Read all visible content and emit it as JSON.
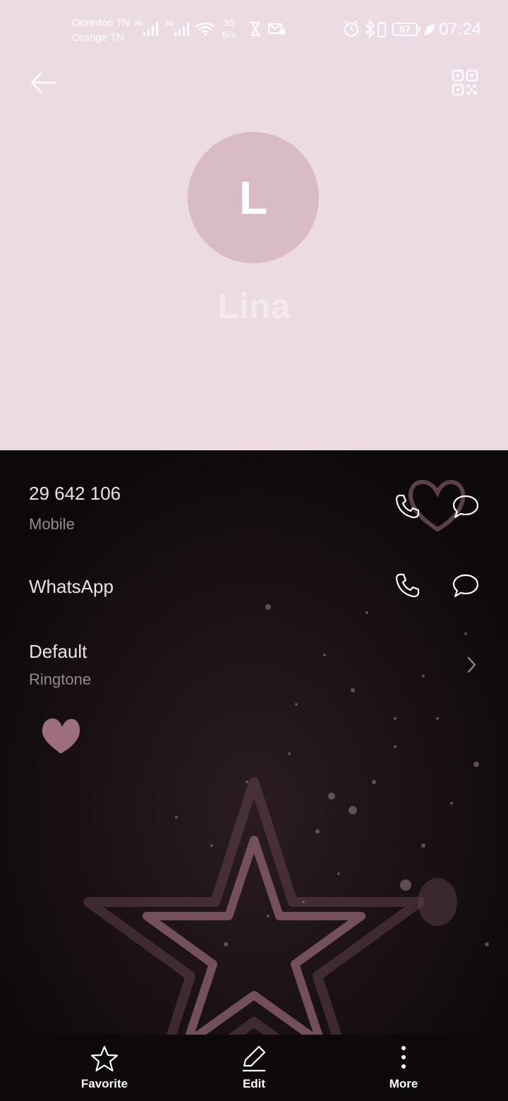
{
  "status_bar": {
    "carrier_1": "Ooredoo TN",
    "carrier_2": "Orange TN",
    "network_1": "3G",
    "network_2": "4G",
    "speed_value": "35",
    "speed_unit": "B/s",
    "battery": "57",
    "time": "07:24"
  },
  "header": {
    "back_icon": "arrow-left-icon",
    "qr_icon": "qr-code-icon"
  },
  "contact": {
    "initial": "L",
    "name": "Lina"
  },
  "details": {
    "phone": {
      "number": "29 642 106",
      "type": "Mobile"
    },
    "whatsapp": {
      "label": "WhatsApp"
    },
    "ringtone": {
      "value": "Default",
      "label": "Ringtone"
    }
  },
  "bottom_nav": {
    "favorite": "Favorite",
    "edit": "Edit",
    "more": "More"
  },
  "colors": {
    "header_bg": "#ecdbe2",
    "avatar_bg": "#d8bbc5",
    "dark_bg": "#0d080b",
    "accent_pink": "#8c5f6e"
  }
}
